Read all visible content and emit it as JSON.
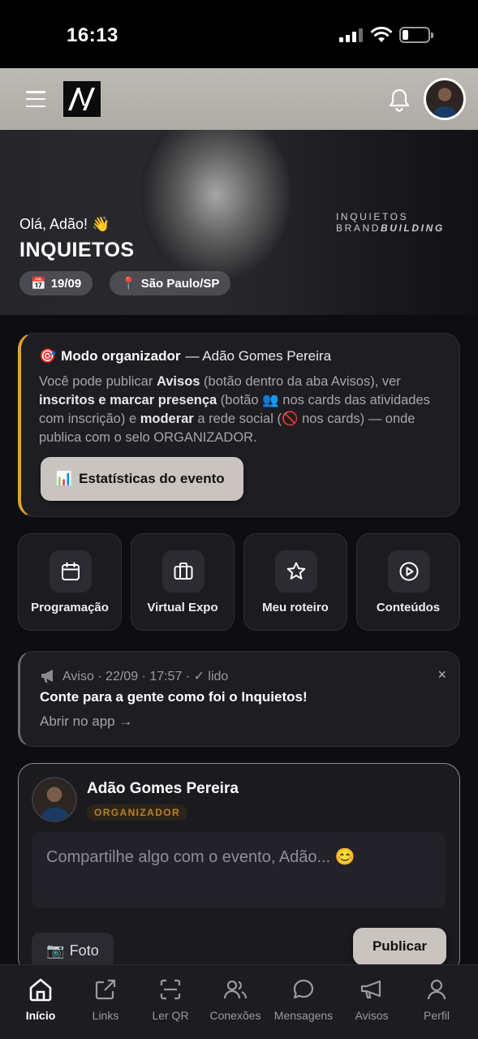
{
  "status": {
    "time": "16:13"
  },
  "hero": {
    "greeting": "Olá, Adão! 👋",
    "title": "INQUIETOS",
    "brand_line1": "INQUIETOS",
    "brand_line2_a": "BRAND",
    "brand_line2_b": "BUILDING",
    "date": "19/09",
    "location": "São Paulo/SP"
  },
  "organizer": {
    "mode_label": "Modo organizador",
    "name": "— Adão Gomes Pereira",
    "text_1": "Você pode publicar ",
    "text_avisos": "Avisos",
    "text_2": " (botão dentro da aba Avisos), ver ",
    "text_inscritos": "inscritos e marcar presença",
    "text_3": " (botão 👥 nos cards das atividades com inscrição) e ",
    "text_moderar": "moderar",
    "text_4": " a rede social (🚫 nos cards) — onde publica com o selo ORGANIZADOR.",
    "stats_button": "Estatísticas do evento"
  },
  "tiles": [
    {
      "label": "Programação",
      "icon": "calendar-icon"
    },
    {
      "label": "Virtual Expo",
      "icon": "briefcase-icon"
    },
    {
      "label": "Meu roteiro",
      "icon": "star-icon"
    },
    {
      "label": "Conteúdos",
      "icon": "play-circle-icon"
    }
  ],
  "notice": {
    "meta": "Aviso · 22/09 · 17:57 · ✓ lido",
    "title": "Conte para a gente como foi o Inquietos!",
    "link": "Abrir no app →",
    "close": "×"
  },
  "composer": {
    "name": "Adão Gomes Pereira",
    "badge": "ORGANIZADOR",
    "placeholder": "Compartilhe algo com o evento, Adão... 😊",
    "photo_button": "Foto",
    "publish_button": "Publicar"
  },
  "nav": [
    {
      "label": "Início",
      "active": true
    },
    {
      "label": "Links"
    },
    {
      "label": "Ler QR"
    },
    {
      "label": "Conexões"
    },
    {
      "label": "Mensagens"
    },
    {
      "label": "Avisos"
    },
    {
      "label": "Perfil"
    }
  ],
  "colors": {
    "accent": "#e0a32c",
    "background": "#0e0e12",
    "card": "#1d1d22",
    "button_light": "#c9c4c0"
  }
}
